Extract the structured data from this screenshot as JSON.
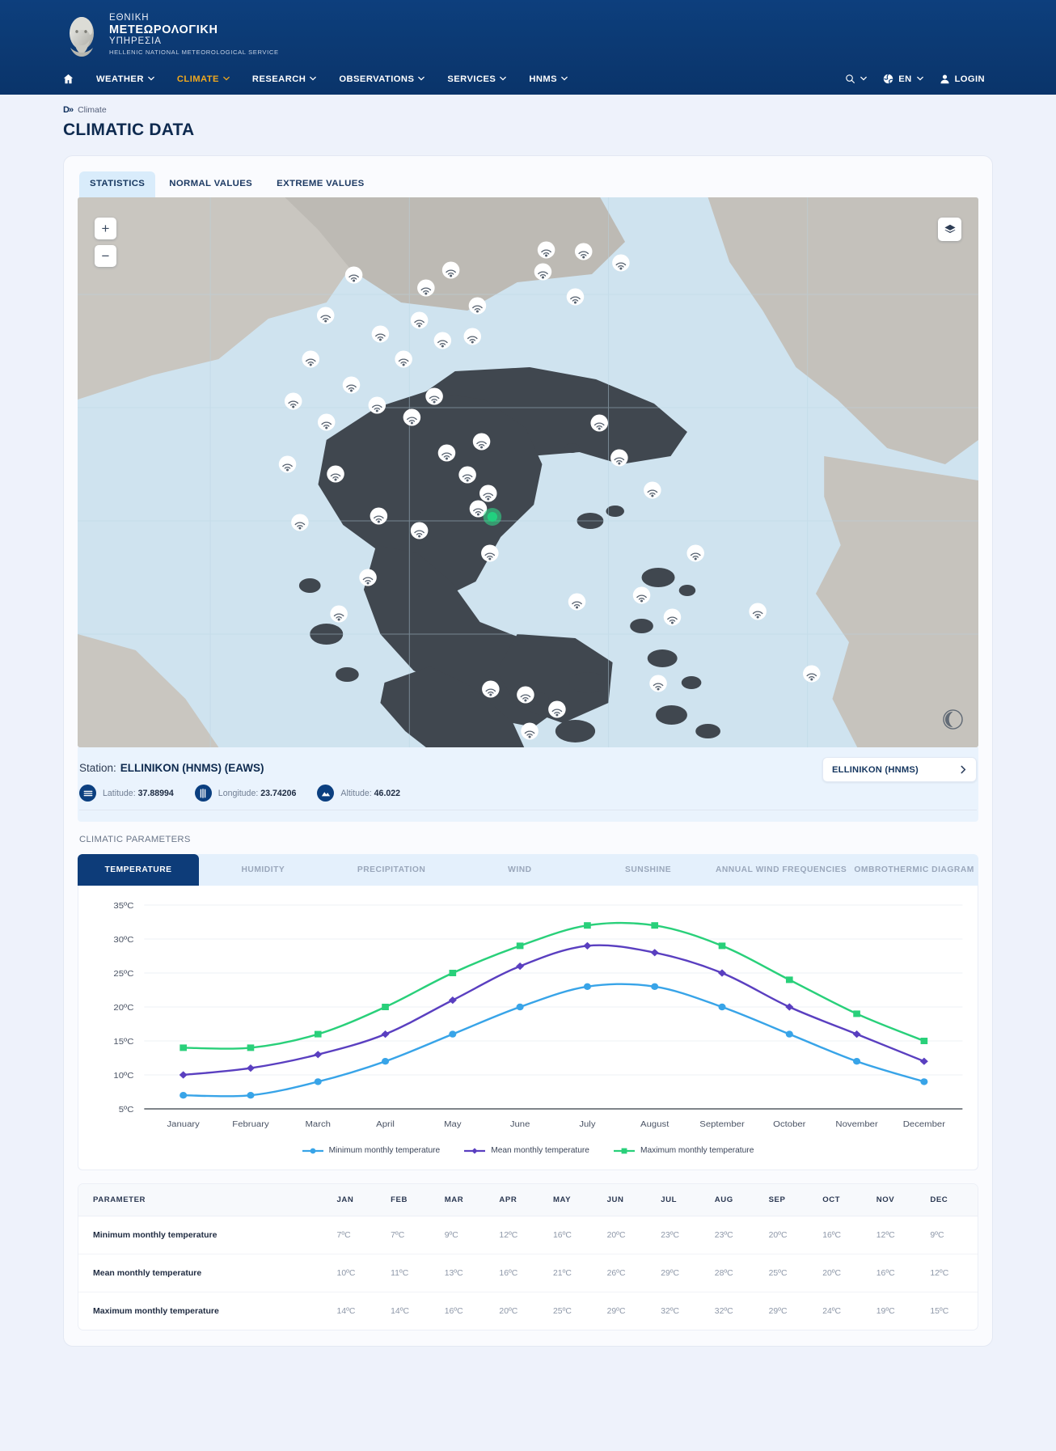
{
  "brand": {
    "line1": "ΕΘΝΙΚΗ",
    "line2": "ΜΕΤΕΩΡΟΛΟΓΙΚΗ",
    "line3": "ΥΠΗΡΕΣΙΑ",
    "line4": "HELLENIC NATIONAL METEOROLOGICAL SERVICE"
  },
  "nav": {
    "items": [
      {
        "label": "WEATHER",
        "active": false,
        "caret": true
      },
      {
        "label": "CLIMATE",
        "active": true,
        "caret": true
      },
      {
        "label": "RESEARCH",
        "active": false,
        "caret": true
      },
      {
        "label": "OBSERVATIONS",
        "active": false,
        "caret": true
      },
      {
        "label": "SERVICES",
        "active": false,
        "caret": true
      },
      {
        "label": "HNMS",
        "active": false,
        "caret": true
      }
    ],
    "util": {
      "language": "EN",
      "login": "LOGIN"
    }
  },
  "breadcrumb": {
    "icon": "D»",
    "label": "Climate"
  },
  "page_title": "CLIMATIC DATA",
  "tabs": [
    {
      "label": "STATISTICS",
      "active": true
    },
    {
      "label": "NORMAL VALUES",
      "active": false
    },
    {
      "label": "EXTREME VALUES",
      "active": false
    }
  ],
  "map": {
    "zoom_in": "+",
    "zoom_out": "−"
  },
  "station": {
    "label": "Station:",
    "name": "ELLINIKON (HNMS) (EAWS)",
    "latitude_label": "Latitude:",
    "latitude": "37.88994",
    "longitude_label": "Longitude:",
    "longitude": "23.74206",
    "altitude_label": "Altitude:",
    "altitude": "46.022",
    "selector_label": "ELLINIKON (HNMS)"
  },
  "climatic_parameters": {
    "title": "CLIMATIC PARAMETERS",
    "tabs": [
      {
        "label": "TEMPERATURE",
        "active": true
      },
      {
        "label": "HUMIDITY",
        "active": false
      },
      {
        "label": "PRECIPITATION",
        "active": false
      },
      {
        "label": "WIND",
        "active": false
      },
      {
        "label": "SUNSHINE",
        "active": false
      },
      {
        "label": "ANNUAL WIND FREQUENCIES",
        "active": false
      },
      {
        "label": "OMBROTHERMIC DIAGRAM",
        "active": false
      }
    ]
  },
  "chart_data": {
    "type": "line",
    "title": "",
    "xlabel": "",
    "ylabel": "",
    "ylim": [
      5,
      35
    ],
    "yticks": [
      5,
      10,
      15,
      20,
      25,
      30,
      35
    ],
    "ytick_labels": [
      "5ºC",
      "10ºC",
      "15ºC",
      "20ºC",
      "25ºC",
      "30ºC",
      "35ºC"
    ],
    "grid": true,
    "legend_position": "bottom",
    "categories": [
      "January",
      "February",
      "March",
      "April",
      "May",
      "June",
      "July",
      "August",
      "September",
      "October",
      "November",
      "December"
    ],
    "series": [
      {
        "name": "Minimum monthly temperature",
        "color": "#38a4e8",
        "marker": "circle",
        "values": [
          7,
          7,
          9,
          12,
          16,
          20,
          23,
          23,
          20,
          16,
          12,
          9
        ]
      },
      {
        "name": "Mean monthly temperature",
        "color": "#5a3fc0",
        "marker": "diamond",
        "values": [
          10,
          11,
          13,
          16,
          21,
          26,
          29,
          28,
          25,
          20,
          16,
          12
        ]
      },
      {
        "name": "Maximum monthly temperature",
        "color": "#29d07a",
        "marker": "square",
        "values": [
          14,
          14,
          16,
          20,
          25,
          29,
          32,
          32,
          29,
          24,
          19,
          15
        ]
      }
    ]
  },
  "table": {
    "columns": [
      "PARAMETER",
      "JAN",
      "FEB",
      "MAR",
      "APR",
      "MAY",
      "JUN",
      "JUL",
      "AUG",
      "SEP",
      "OCT",
      "NOV",
      "DEC"
    ],
    "rows": [
      {
        "parameter": "Minimum monthly temperature",
        "values": [
          "7ºC",
          "7ºC",
          "9ºC",
          "12ºC",
          "16ºC",
          "20ºC",
          "23ºC",
          "23ºC",
          "20ºC",
          "16ºC",
          "12ºC",
          "9ºC"
        ]
      },
      {
        "parameter": "Mean monthly temperature",
        "values": [
          "10ºC",
          "11ºC",
          "13ºC",
          "16ºC",
          "21ºC",
          "26ºC",
          "29ºC",
          "28ºC",
          "25ºC",
          "20ºC",
          "16ºC",
          "12ºC"
        ]
      },
      {
        "parameter": "Maximum monthly temperature",
        "values": [
          "14ºC",
          "14ºC",
          "16ºC",
          "20ºC",
          "25ºC",
          "29ºC",
          "32ºC",
          "32ºC",
          "29ºC",
          "24ºC",
          "19ºC",
          "15ºC"
        ]
      }
    ]
  },
  "colors": {
    "brand_navy": "#0d3f7d",
    "accent_gold": "#f0a81e",
    "min_series": "#38a4e8",
    "mean_series": "#5a3fc0",
    "max_series": "#29d07a"
  }
}
